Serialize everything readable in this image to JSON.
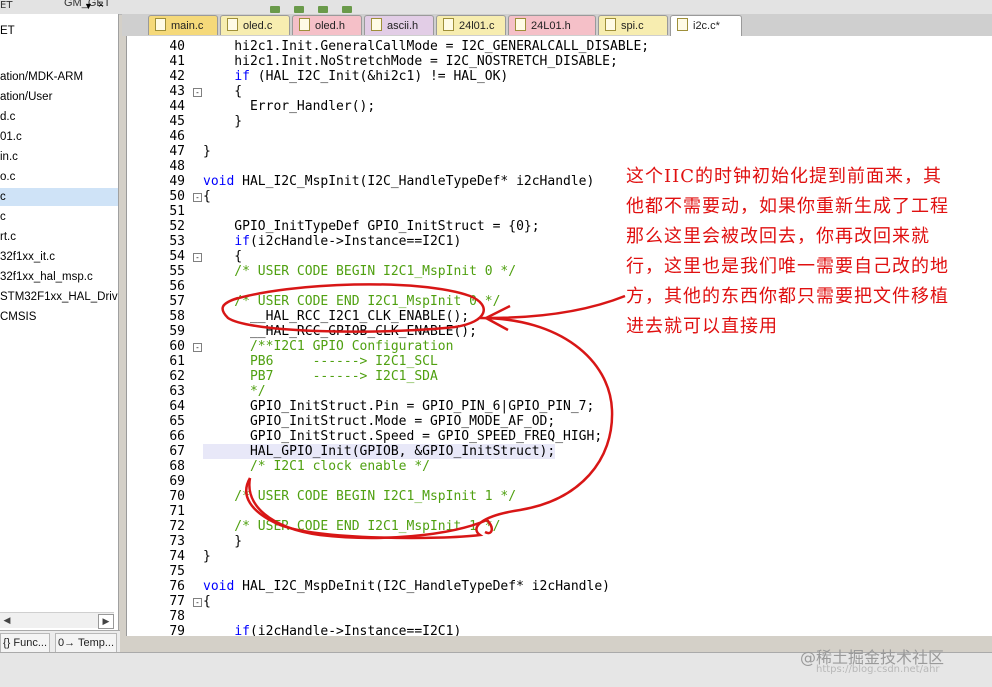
{
  "titlebar": {
    "left_text": "ET",
    "project_label": "GM_GET"
  },
  "project_tree": [
    {
      "label": "ET",
      "selected": false
    },
    {
      "label": "ation/MDK-ARM",
      "selected": false
    },
    {
      "label": "ation/User",
      "selected": false
    },
    {
      "label": "d.c",
      "selected": false
    },
    {
      "label": "01.c",
      "selected": false
    },
    {
      "label": "in.c",
      "selected": false
    },
    {
      "label": "o.c",
      "selected": false
    },
    {
      "label": "c",
      "selected": true
    },
    {
      "label": "c",
      "selected": false
    },
    {
      "label": "rt.c",
      "selected": false
    },
    {
      "label": "32f1xx_it.c",
      "selected": false
    },
    {
      "label": "32f1xx_hal_msp.c",
      "selected": false
    },
    {
      "label": "STM32F1xx_HAL_Driv",
      "selected": false
    },
    {
      "label": "CMSIS",
      "selected": false
    }
  ],
  "bottom_tabs": [
    {
      "label": "{} Func..."
    },
    {
      "label": "0→ Temp..."
    }
  ],
  "tabs": [
    {
      "label": "main.c",
      "color": "#f5d97a"
    },
    {
      "label": "oled.c",
      "color": "#f7edb0"
    },
    {
      "label": "oled.h",
      "color": "#f5c0c8"
    },
    {
      "label": "ascii.h",
      "color": "#e2cde6"
    },
    {
      "label": "24l01.c",
      "color": "#f7edb0"
    },
    {
      "label": "24L01.h",
      "color": "#f5c0c8"
    },
    {
      "label": "spi.c",
      "color": "#f7edb0"
    },
    {
      "label": "i2c.c*",
      "color": "#ffffff"
    }
  ],
  "code_lines": [
    {
      "num": "40",
      "fold": "",
      "parts": [
        {
          "t": "    hi2c1.Init.GeneralCallMode = I2C_GENERALCALL_DISABLE;",
          "c": "n"
        }
      ]
    },
    {
      "num": "41",
      "fold": "",
      "parts": [
        {
          "t": "    hi2c1.Init.NoStretchMode = I2C_NOSTRETCH_DISABLE;",
          "c": "n"
        }
      ]
    },
    {
      "num": "42",
      "fold": "",
      "parts": [
        {
          "t": "    ",
          "c": "n"
        },
        {
          "t": "if",
          "c": "k"
        },
        {
          "t": " (HAL_I2C_Init(&hi2c1) != HAL_OK)",
          "c": "n"
        }
      ]
    },
    {
      "num": "43",
      "fold": "-",
      "parts": [
        {
          "t": "    {",
          "c": "n"
        }
      ]
    },
    {
      "num": "44",
      "fold": "",
      "parts": [
        {
          "t": "      Error_Handler();",
          "c": "n"
        }
      ]
    },
    {
      "num": "45",
      "fold": "",
      "parts": [
        {
          "t": "    }",
          "c": "n"
        }
      ]
    },
    {
      "num": "46",
      "fold": "",
      "parts": [
        {
          "t": "",
          "c": "n"
        }
      ]
    },
    {
      "num": "47",
      "fold": "",
      "parts": [
        {
          "t": "}",
          "c": "n"
        }
      ]
    },
    {
      "num": "48",
      "fold": "",
      "parts": [
        {
          "t": "",
          "c": "n"
        }
      ]
    },
    {
      "num": "49",
      "fold": "",
      "parts": [
        {
          "t": "void",
          "c": "k"
        },
        {
          "t": " HAL_I2C_MspInit(I2C_HandleTypeDef* i2cHandle)",
          "c": "n"
        }
      ]
    },
    {
      "num": "50",
      "fold": "-",
      "parts": [
        {
          "t": "{",
          "c": "n"
        }
      ]
    },
    {
      "num": "51",
      "fold": "",
      "parts": [
        {
          "t": "",
          "c": "n"
        }
      ]
    },
    {
      "num": "52",
      "fold": "",
      "parts": [
        {
          "t": "    GPIO_InitTypeDef GPIO_InitStruct = {0};",
          "c": "n"
        }
      ]
    },
    {
      "num": "53",
      "fold": "",
      "parts": [
        {
          "t": "    ",
          "c": "n"
        },
        {
          "t": "if",
          "c": "k"
        },
        {
          "t": "(i2cHandle->Instance==I2C1)",
          "c": "n"
        }
      ]
    },
    {
      "num": "54",
      "fold": "-",
      "parts": [
        {
          "t": "    {",
          "c": "n"
        }
      ]
    },
    {
      "num": "55",
      "fold": "",
      "parts": [
        {
          "t": "    /* USER CODE BEGIN I2C1_MspInit 0 */",
          "c": "c"
        }
      ]
    },
    {
      "num": "56",
      "fold": "",
      "parts": [
        {
          "t": "",
          "c": "n"
        }
      ]
    },
    {
      "num": "57",
      "fold": "",
      "parts": [
        {
          "t": "    /* USER CODE END I2C1_MspInit 0 */",
          "c": "c"
        }
      ]
    },
    {
      "num": "58",
      "fold": "",
      "parts": [
        {
          "t": "      __HAL_RCC_I2C1_CLK_ENABLE();",
          "c": "n"
        }
      ]
    },
    {
      "num": "59",
      "fold": "",
      "parts": [
        {
          "t": "      __HAL_RCC_GPIOB_CLK_ENABLE();",
          "c": "n"
        }
      ]
    },
    {
      "num": "60",
      "fold": "-",
      "parts": [
        {
          "t": "      /**I2C1 GPIO Configuration",
          "c": "c"
        }
      ]
    },
    {
      "num": "61",
      "fold": "",
      "parts": [
        {
          "t": "      PB6     ------> I2C1_SCL",
          "c": "c"
        }
      ]
    },
    {
      "num": "62",
      "fold": "",
      "parts": [
        {
          "t": "      PB7     ------> I2C1_SDA",
          "c": "c"
        }
      ]
    },
    {
      "num": "63",
      "fold": "",
      "parts": [
        {
          "t": "      */",
          "c": "c"
        }
      ]
    },
    {
      "num": "64",
      "fold": "",
      "parts": [
        {
          "t": "      GPIO_InitStruct.Pin = GPIO_PIN_6|GPIO_PIN_7;",
          "c": "n"
        }
      ]
    },
    {
      "num": "65",
      "fold": "",
      "parts": [
        {
          "t": "      GPIO_InitStruct.Mode = GPIO_MODE_AF_OD;",
          "c": "n"
        }
      ]
    },
    {
      "num": "66",
      "fold": "",
      "parts": [
        {
          "t": "      GPIO_InitStruct.Speed = GPIO_SPEED_FREQ_HIGH;",
          "c": "n"
        }
      ]
    },
    {
      "num": "67",
      "fold": "",
      "parts": [
        {
          "t": "      HAL_GPIO_Init(GPIOB, &GPIO_InitStruct);",
          "c": "n"
        }
      ],
      "current": true
    },
    {
      "num": "68",
      "fold": "",
      "parts": [
        {
          "t": "      /* I2C1 clock enable */",
          "c": "c"
        }
      ]
    },
    {
      "num": "69",
      "fold": "",
      "parts": [
        {
          "t": "",
          "c": "n"
        }
      ]
    },
    {
      "num": "70",
      "fold": "",
      "parts": [
        {
          "t": "    /* USER CODE BEGIN I2C1_MspInit 1 */",
          "c": "c"
        }
      ]
    },
    {
      "num": "71",
      "fold": "",
      "parts": [
        {
          "t": "",
          "c": "n"
        }
      ]
    },
    {
      "num": "72",
      "fold": "",
      "parts": [
        {
          "t": "    /* USER CODE END I2C1_MspInit 1 */",
          "c": "c"
        }
      ]
    },
    {
      "num": "73",
      "fold": "",
      "parts": [
        {
          "t": "    }",
          "c": "n"
        }
      ]
    },
    {
      "num": "74",
      "fold": "",
      "parts": [
        {
          "t": "}",
          "c": "n"
        }
      ]
    },
    {
      "num": "75",
      "fold": "",
      "parts": [
        {
          "t": "",
          "c": "n"
        }
      ]
    },
    {
      "num": "76",
      "fold": "",
      "parts": [
        {
          "t": "void",
          "c": "k"
        },
        {
          "t": " HAL_I2C_MspDeInit(I2C_HandleTypeDef* i2cHandle)",
          "c": "n"
        }
      ]
    },
    {
      "num": "77",
      "fold": "-",
      "parts": [
        {
          "t": "{",
          "c": "n"
        }
      ]
    },
    {
      "num": "78",
      "fold": "",
      "parts": [
        {
          "t": "",
          "c": "n"
        }
      ]
    },
    {
      "num": "79",
      "fold": "",
      "parts": [
        {
          "t": "    ",
          "c": "n"
        },
        {
          "t": "if",
          "c": "k"
        },
        {
          "t": "(i2cHandle->Instance==I2C1)",
          "c": "n"
        }
      ]
    }
  ],
  "annotation": {
    "text": "这个IIC的时钟初始化提到前面来，其他都不需要动，如果你重新生成了工程那么这里会被改回去，你再改回来就行，这里也是我们唯一需要自己改的地方，其他的东西你都只需要把文件移植进去就可以直接用",
    "color": "#e01010"
  },
  "watermark": {
    "text": "@稀土掘金技术社区",
    "subtext": "https://blog.csdn.net/ahr"
  }
}
